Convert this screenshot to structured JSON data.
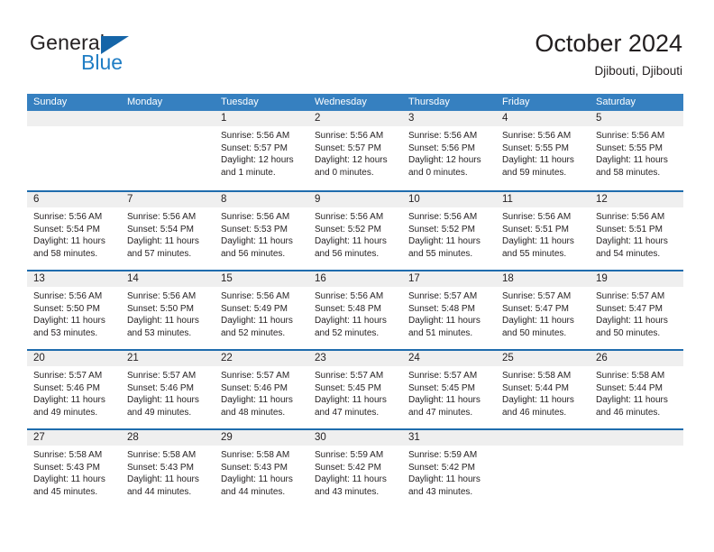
{
  "brand": {
    "line1": "General",
    "line2": "Blue",
    "triangle_color": "#1565a8",
    "blue_text_color": "#1f7dc4"
  },
  "header": {
    "title": "October 2024",
    "subtitle": "Djibouti, Djibouti",
    "header_bg": "#3680c0",
    "row_divider": "#1f6cad",
    "day_band_bg": "#efefef"
  },
  "weekdays": [
    "Sunday",
    "Monday",
    "Tuesday",
    "Wednesday",
    "Thursday",
    "Friday",
    "Saturday"
  ],
  "weeks": [
    [
      {
        "day": "",
        "empty": true
      },
      {
        "day": "",
        "empty": true
      },
      {
        "day": "1",
        "sunrise": "Sunrise: 5:56 AM",
        "sunset": "Sunset: 5:57 PM",
        "daylight1": "Daylight: 12 hours",
        "daylight2": "and 1 minute."
      },
      {
        "day": "2",
        "sunrise": "Sunrise: 5:56 AM",
        "sunset": "Sunset: 5:57 PM",
        "daylight1": "Daylight: 12 hours",
        "daylight2": "and 0 minutes."
      },
      {
        "day": "3",
        "sunrise": "Sunrise: 5:56 AM",
        "sunset": "Sunset: 5:56 PM",
        "daylight1": "Daylight: 12 hours",
        "daylight2": "and 0 minutes."
      },
      {
        "day": "4",
        "sunrise": "Sunrise: 5:56 AM",
        "sunset": "Sunset: 5:55 PM",
        "daylight1": "Daylight: 11 hours",
        "daylight2": "and 59 minutes."
      },
      {
        "day": "5",
        "sunrise": "Sunrise: 5:56 AM",
        "sunset": "Sunset: 5:55 PM",
        "daylight1": "Daylight: 11 hours",
        "daylight2": "and 58 minutes."
      }
    ],
    [
      {
        "day": "6",
        "sunrise": "Sunrise: 5:56 AM",
        "sunset": "Sunset: 5:54 PM",
        "daylight1": "Daylight: 11 hours",
        "daylight2": "and 58 minutes."
      },
      {
        "day": "7",
        "sunrise": "Sunrise: 5:56 AM",
        "sunset": "Sunset: 5:54 PM",
        "daylight1": "Daylight: 11 hours",
        "daylight2": "and 57 minutes."
      },
      {
        "day": "8",
        "sunrise": "Sunrise: 5:56 AM",
        "sunset": "Sunset: 5:53 PM",
        "daylight1": "Daylight: 11 hours",
        "daylight2": "and 56 minutes."
      },
      {
        "day": "9",
        "sunrise": "Sunrise: 5:56 AM",
        "sunset": "Sunset: 5:52 PM",
        "daylight1": "Daylight: 11 hours",
        "daylight2": "and 56 minutes."
      },
      {
        "day": "10",
        "sunrise": "Sunrise: 5:56 AM",
        "sunset": "Sunset: 5:52 PM",
        "daylight1": "Daylight: 11 hours",
        "daylight2": "and 55 minutes."
      },
      {
        "day": "11",
        "sunrise": "Sunrise: 5:56 AM",
        "sunset": "Sunset: 5:51 PM",
        "daylight1": "Daylight: 11 hours",
        "daylight2": "and 55 minutes."
      },
      {
        "day": "12",
        "sunrise": "Sunrise: 5:56 AM",
        "sunset": "Sunset: 5:51 PM",
        "daylight1": "Daylight: 11 hours",
        "daylight2": "and 54 minutes."
      }
    ],
    [
      {
        "day": "13",
        "sunrise": "Sunrise: 5:56 AM",
        "sunset": "Sunset: 5:50 PM",
        "daylight1": "Daylight: 11 hours",
        "daylight2": "and 53 minutes."
      },
      {
        "day": "14",
        "sunrise": "Sunrise: 5:56 AM",
        "sunset": "Sunset: 5:50 PM",
        "daylight1": "Daylight: 11 hours",
        "daylight2": "and 53 minutes."
      },
      {
        "day": "15",
        "sunrise": "Sunrise: 5:56 AM",
        "sunset": "Sunset: 5:49 PM",
        "daylight1": "Daylight: 11 hours",
        "daylight2": "and 52 minutes."
      },
      {
        "day": "16",
        "sunrise": "Sunrise: 5:56 AM",
        "sunset": "Sunset: 5:48 PM",
        "daylight1": "Daylight: 11 hours",
        "daylight2": "and 52 minutes."
      },
      {
        "day": "17",
        "sunrise": "Sunrise: 5:57 AM",
        "sunset": "Sunset: 5:48 PM",
        "daylight1": "Daylight: 11 hours",
        "daylight2": "and 51 minutes."
      },
      {
        "day": "18",
        "sunrise": "Sunrise: 5:57 AM",
        "sunset": "Sunset: 5:47 PM",
        "daylight1": "Daylight: 11 hours",
        "daylight2": "and 50 minutes."
      },
      {
        "day": "19",
        "sunrise": "Sunrise: 5:57 AM",
        "sunset": "Sunset: 5:47 PM",
        "daylight1": "Daylight: 11 hours",
        "daylight2": "and 50 minutes."
      }
    ],
    [
      {
        "day": "20",
        "sunrise": "Sunrise: 5:57 AM",
        "sunset": "Sunset: 5:46 PM",
        "daylight1": "Daylight: 11 hours",
        "daylight2": "and 49 minutes."
      },
      {
        "day": "21",
        "sunrise": "Sunrise: 5:57 AM",
        "sunset": "Sunset: 5:46 PM",
        "daylight1": "Daylight: 11 hours",
        "daylight2": "and 49 minutes."
      },
      {
        "day": "22",
        "sunrise": "Sunrise: 5:57 AM",
        "sunset": "Sunset: 5:46 PM",
        "daylight1": "Daylight: 11 hours",
        "daylight2": "and 48 minutes."
      },
      {
        "day": "23",
        "sunrise": "Sunrise: 5:57 AM",
        "sunset": "Sunset: 5:45 PM",
        "daylight1": "Daylight: 11 hours",
        "daylight2": "and 47 minutes."
      },
      {
        "day": "24",
        "sunrise": "Sunrise: 5:57 AM",
        "sunset": "Sunset: 5:45 PM",
        "daylight1": "Daylight: 11 hours",
        "daylight2": "and 47 minutes."
      },
      {
        "day": "25",
        "sunrise": "Sunrise: 5:58 AM",
        "sunset": "Sunset: 5:44 PM",
        "daylight1": "Daylight: 11 hours",
        "daylight2": "and 46 minutes."
      },
      {
        "day": "26",
        "sunrise": "Sunrise: 5:58 AM",
        "sunset": "Sunset: 5:44 PM",
        "daylight1": "Daylight: 11 hours",
        "daylight2": "and 46 minutes."
      }
    ],
    [
      {
        "day": "27",
        "sunrise": "Sunrise: 5:58 AM",
        "sunset": "Sunset: 5:43 PM",
        "daylight1": "Daylight: 11 hours",
        "daylight2": "and 45 minutes."
      },
      {
        "day": "28",
        "sunrise": "Sunrise: 5:58 AM",
        "sunset": "Sunset: 5:43 PM",
        "daylight1": "Daylight: 11 hours",
        "daylight2": "and 44 minutes."
      },
      {
        "day": "29",
        "sunrise": "Sunrise: 5:58 AM",
        "sunset": "Sunset: 5:43 PM",
        "daylight1": "Daylight: 11 hours",
        "daylight2": "and 44 minutes."
      },
      {
        "day": "30",
        "sunrise": "Sunrise: 5:59 AM",
        "sunset": "Sunset: 5:42 PM",
        "daylight1": "Daylight: 11 hours",
        "daylight2": "and 43 minutes."
      },
      {
        "day": "31",
        "sunrise": "Sunrise: 5:59 AM",
        "sunset": "Sunset: 5:42 PM",
        "daylight1": "Daylight: 11 hours",
        "daylight2": "and 43 minutes."
      },
      {
        "day": "",
        "empty": true
      },
      {
        "day": "",
        "empty": true
      }
    ]
  ]
}
